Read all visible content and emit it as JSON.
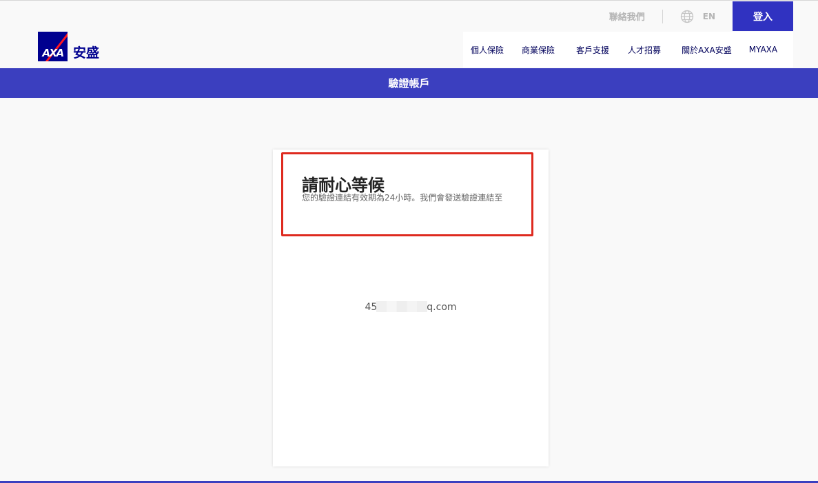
{
  "brand": {
    "logo_letters": "AXA",
    "logo_text": "安盛",
    "color_primary": "#00008f",
    "color_accent": "#ff1721"
  },
  "utility_nav": {
    "contact_label": "聯絡我們",
    "language_label": "EN",
    "language_icon": "globe-icon",
    "login_label": "登入"
  },
  "main_nav": [
    {
      "label": "個人保險"
    },
    {
      "label": "商業保險"
    },
    {
      "label": "客戶支援"
    },
    {
      "label": "人才招募"
    },
    {
      "label": "關於AXA安盛"
    },
    {
      "label": "MYAXA"
    }
  ],
  "page": {
    "title": "驗證帳戶",
    "band_color": "#3b3fbf"
  },
  "card": {
    "heading": "請耐心等候",
    "description": "您的驗證連結有效期為24小時。我們會發送驗證連結至",
    "email_prefix": "45",
    "email_suffix": "q.com",
    "highlight_color": "#de2a1f"
  }
}
